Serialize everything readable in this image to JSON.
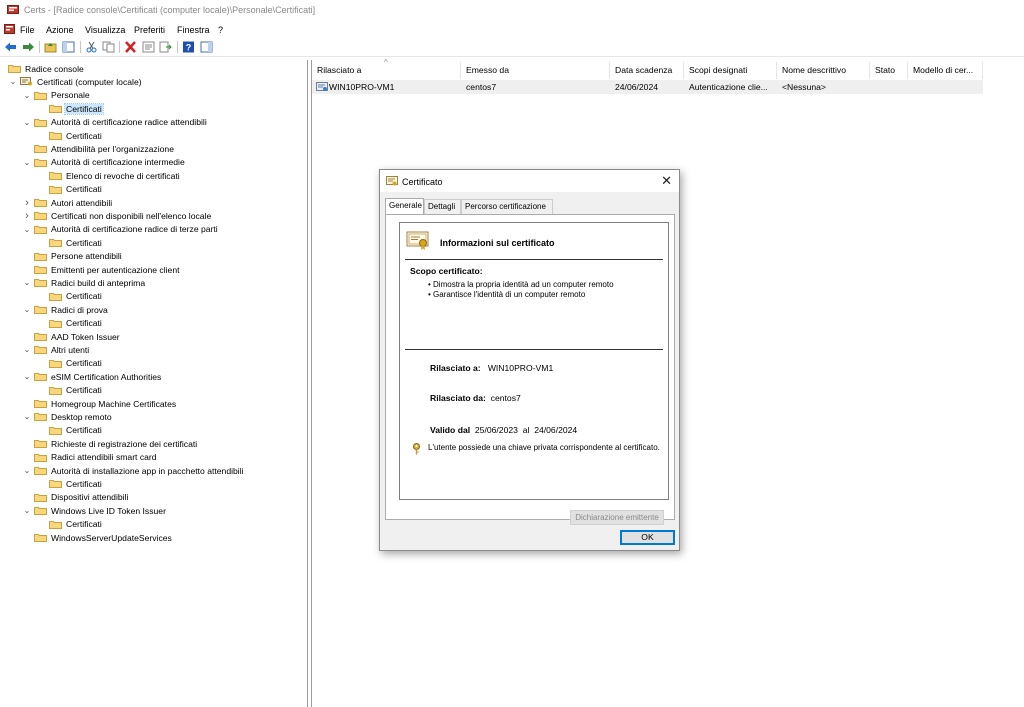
{
  "window": {
    "title": "Certs - [Radice console\\Certificati (computer locale)\\Personale\\Certificati]"
  },
  "menu": [
    "File",
    "Azione",
    "Visualizza",
    "Preferiti",
    "Finestra",
    "?"
  ],
  "toolbar": [
    "back-arrow-icon",
    "forward-arrow-icon",
    "up-folder-icon",
    "show-tree-icon",
    "cut-icon",
    "copy-icon",
    "delete-icon",
    "properties-icon",
    "export-list-icon",
    "help-icon",
    "show-action-pane-icon"
  ],
  "tree": [
    {
      "label": "Radice console",
      "indent": 0,
      "chev": "",
      "icon": "folder"
    },
    {
      "label": "Certificati (computer locale)",
      "indent": 1,
      "chev": "v",
      "icon": "snapin"
    },
    {
      "label": "Personale",
      "indent": 2,
      "chev": "v",
      "icon": "folder"
    },
    {
      "label": "Certificati",
      "indent": 3,
      "chev": "",
      "icon": "folder",
      "selected": true
    },
    {
      "label": "Autorità di certificazione radice attendibili",
      "indent": 2,
      "chev": "v",
      "icon": "folder"
    },
    {
      "label": "Certificati",
      "indent": 3,
      "chev": "",
      "icon": "folder"
    },
    {
      "label": "Attendibilità per l'organizzazione",
      "indent": 2,
      "chev": "",
      "icon": "folder"
    },
    {
      "label": "Autorità di certificazione intermedie",
      "indent": 2,
      "chev": "v",
      "icon": "folder"
    },
    {
      "label": "Elenco di revoche di certificati",
      "indent": 3,
      "chev": "",
      "icon": "folder"
    },
    {
      "label": "Certificati",
      "indent": 3,
      "chev": "",
      "icon": "folder"
    },
    {
      "label": "Autori attendibili",
      "indent": 2,
      "chev": ">",
      "icon": "folder"
    },
    {
      "label": "Certificati non disponibili nell'elenco locale",
      "indent": 2,
      "chev": ">",
      "icon": "folder"
    },
    {
      "label": "Autorità di certificazione radice di terze parti",
      "indent": 2,
      "chev": "v",
      "icon": "folder"
    },
    {
      "label": "Certificati",
      "indent": 3,
      "chev": "",
      "icon": "folder"
    },
    {
      "label": "Persone attendibili",
      "indent": 2,
      "chev": "",
      "icon": "folder"
    },
    {
      "label": "Emittenti per autenticazione client",
      "indent": 2,
      "chev": "",
      "icon": "folder"
    },
    {
      "label": "Radici build di anteprima",
      "indent": 2,
      "chev": "v",
      "icon": "folder"
    },
    {
      "label": "Certificati",
      "indent": 3,
      "chev": "",
      "icon": "folder"
    },
    {
      "label": "Radici di prova",
      "indent": 2,
      "chev": "v",
      "icon": "folder"
    },
    {
      "label": "Certificati",
      "indent": 3,
      "chev": "",
      "icon": "folder"
    },
    {
      "label": "AAD Token Issuer",
      "indent": 2,
      "chev": "",
      "icon": "folder"
    },
    {
      "label": "Altri utenti",
      "indent": 2,
      "chev": "v",
      "icon": "folder"
    },
    {
      "label": "Certificati",
      "indent": 3,
      "chev": "",
      "icon": "folder"
    },
    {
      "label": "eSIM Certification Authorities",
      "indent": 2,
      "chev": "v",
      "icon": "folder"
    },
    {
      "label": "Certificati",
      "indent": 3,
      "chev": "",
      "icon": "folder"
    },
    {
      "label": "Homegroup Machine Certificates",
      "indent": 2,
      "chev": "",
      "icon": "folder"
    },
    {
      "label": "Desktop remoto",
      "indent": 2,
      "chev": "v",
      "icon": "folder"
    },
    {
      "label": "Certificati",
      "indent": 3,
      "chev": "",
      "icon": "folder"
    },
    {
      "label": "Richieste di registrazione dei certificati",
      "indent": 2,
      "chev": "",
      "icon": "folder"
    },
    {
      "label": "Radici attendibili smart card",
      "indent": 2,
      "chev": "",
      "icon": "folder"
    },
    {
      "label": "Autorità di installazione app in pacchetto attendibili",
      "indent": 2,
      "chev": "v",
      "icon": "folder"
    },
    {
      "label": "Certificati",
      "indent": 3,
      "chev": "",
      "icon": "folder"
    },
    {
      "label": "Dispositivi attendibili",
      "indent": 2,
      "chev": "",
      "icon": "folder"
    },
    {
      "label": "Windows Live ID Token Issuer",
      "indent": 2,
      "chev": "v",
      "icon": "folder"
    },
    {
      "label": "Certificati",
      "indent": 3,
      "chev": "",
      "icon": "folder"
    },
    {
      "label": "WindowsServerUpdateServices",
      "indent": 2,
      "chev": "",
      "icon": "folder"
    }
  ],
  "list": {
    "columns": [
      "Rilasciato a",
      "Emesso da",
      "Data scadenza",
      "Scopi designati",
      "Nome descrittivo",
      "Stato",
      "Modello di cer..."
    ],
    "rows": [
      {
        "issued_to": "WIN10PRO-VM1",
        "issued_by": "centos7",
        "expiry": "24/06/2024",
        "purposes": "Autenticazione clie...",
        "friendly": "<Nessuna>",
        "status": "",
        "template": ""
      }
    ]
  },
  "dialog": {
    "title": "Certificato",
    "tabs": [
      "Generale",
      "Dettagli",
      "Percorso certificazione"
    ],
    "info_title": "Informazioni sul certificato",
    "scope_title": "Scopo certificato:",
    "bullets": [
      "• Dimostra la propria identità ad un computer remoto",
      "• Garantisce l'identità di un computer remoto"
    ],
    "issued_to_label": "Rilasciato a:",
    "issued_to_value": "WIN10PRO-VM1",
    "issued_by_label": "Rilasciato da:",
    "issued_by_value": "centos7",
    "valid_from_label": "Valido dal",
    "valid_from_value": "25/06/2023",
    "valid_to_label": "al",
    "valid_to_value": "24/06/2024",
    "key_note": "L'utente possiede una chiave privata corrispondente al certificato.",
    "issuer_statement_button": "Dichiarazione emittente",
    "ok_button": "OK"
  }
}
